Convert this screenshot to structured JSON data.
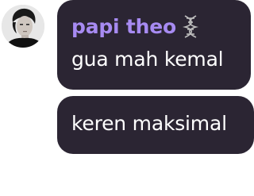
{
  "messages": [
    {
      "sender": "papi theo",
      "badge_icon": "dna-icon",
      "text": "gua mah kemal"
    },
    {
      "text": "keren maksimal"
    }
  ],
  "avatar": {
    "icon": "avatar"
  },
  "colors": {
    "bubble_bg": "#2b2533",
    "sender_name": "#a78bf2",
    "message_text": "#ffffff",
    "page_bg": "#ffffff"
  }
}
